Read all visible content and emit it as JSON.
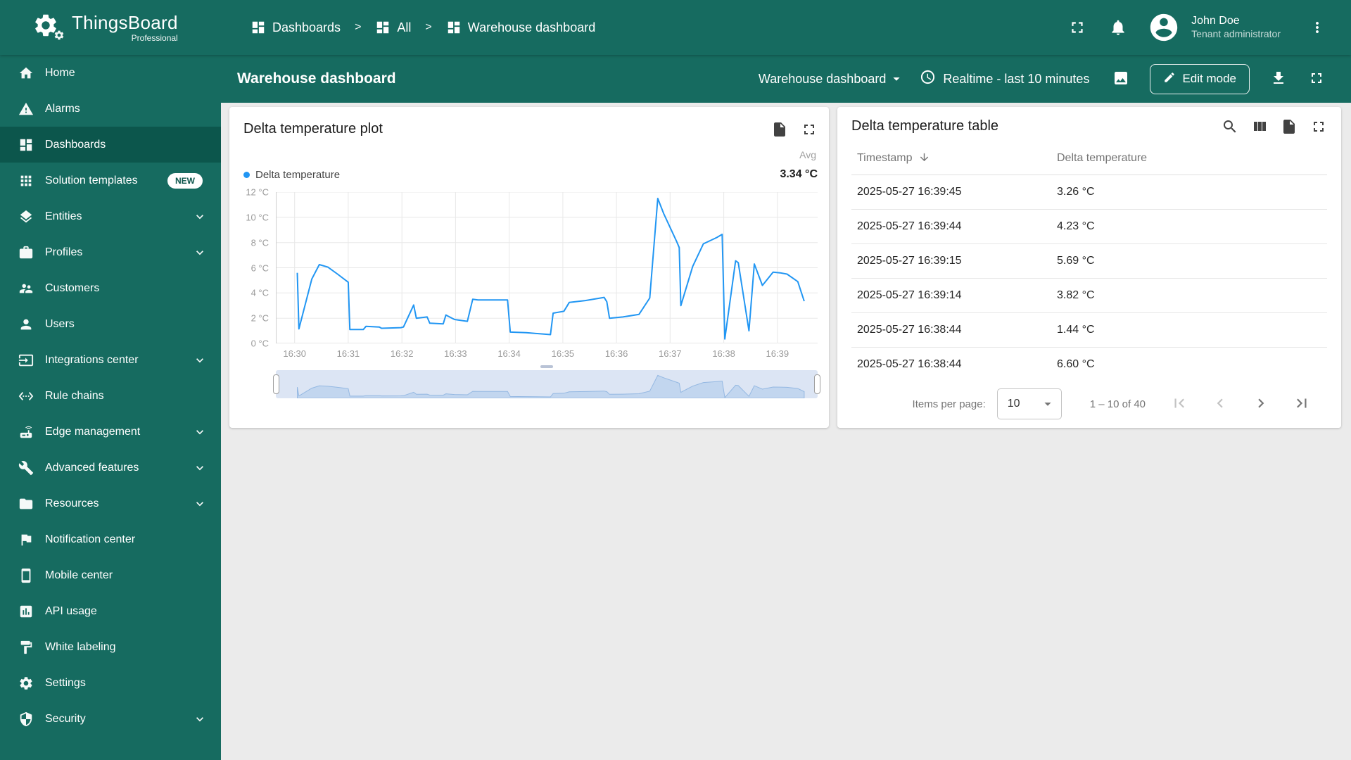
{
  "app": {
    "name": "ThingsBoard",
    "edition": "Professional"
  },
  "breadcrumb": {
    "separator": ">",
    "items": [
      {
        "label": "Dashboards",
        "icon": "dashboard"
      },
      {
        "label": "All",
        "icon": "dashboard"
      },
      {
        "label": "Warehouse dashboard",
        "icon": "dashboard"
      }
    ]
  },
  "user": {
    "name": "John Doe",
    "role": "Tenant administrator"
  },
  "header_actions": [
    "fullscreen",
    "notifications"
  ],
  "sidebar": {
    "items": [
      {
        "label": "Home",
        "icon": "home"
      },
      {
        "label": "Alarms",
        "icon": "alarms"
      },
      {
        "label": "Dashboards",
        "icon": "dashboard",
        "active": true
      },
      {
        "label": "Solution templates",
        "icon": "apps",
        "badge": "NEW"
      },
      {
        "label": "Entities",
        "icon": "entities",
        "expandable": true
      },
      {
        "label": "Profiles",
        "icon": "profiles",
        "expandable": true
      },
      {
        "label": "Customers",
        "icon": "customers"
      },
      {
        "label": "Users",
        "icon": "users"
      },
      {
        "label": "Integrations center",
        "icon": "integrations",
        "expandable": true
      },
      {
        "label": "Rule chains",
        "icon": "rule-chains"
      },
      {
        "label": "Edge management",
        "icon": "edge",
        "expandable": true
      },
      {
        "label": "Advanced features",
        "icon": "advanced",
        "expandable": true
      },
      {
        "label": "Resources",
        "icon": "resources",
        "expandable": true
      },
      {
        "label": "Notification center",
        "icon": "notification"
      },
      {
        "label": "Mobile center",
        "icon": "mobile"
      },
      {
        "label": "API usage",
        "icon": "api-usage"
      },
      {
        "label": "White labeling",
        "icon": "white-labeling"
      },
      {
        "label": "Settings",
        "icon": "settings"
      },
      {
        "label": "Security",
        "icon": "security",
        "expandable": true
      }
    ]
  },
  "toolbar": {
    "title": "Warehouse dashboard",
    "dashboard_select": "Warehouse dashboard",
    "time_window": "Realtime - last 10 minutes",
    "edit_button": "Edit mode",
    "actions": [
      "image",
      "download",
      "fullscreen"
    ]
  },
  "chart_card": {
    "title": "Delta temperature plot",
    "actions": [
      "file-export",
      "fullscreen"
    ],
    "legend": {
      "series_label": "Delta temperature",
      "agg_label": "Avg",
      "agg_value": "3.34 °C"
    }
  },
  "chart_data": {
    "type": "line",
    "title": "Delta temperature plot",
    "series_name": "Delta temperature",
    "color": "#2196f3",
    "ylim": [
      0,
      12
    ],
    "y_ticks": [
      "0 °C",
      "2 °C",
      "4 °C",
      "6 °C",
      "8 °C",
      "10 °C",
      "12 °C"
    ],
    "x_ticks": [
      "16:30",
      "16:31",
      "16:32",
      "16:33",
      "16:34",
      "16:35",
      "16:36",
      "16:37",
      "16:38",
      "16:39"
    ],
    "x_domain": [
      -0.35,
      9.75
    ],
    "grid": true,
    "legend_position": "top",
    "points": [
      [
        0.05,
        5.6
      ],
      [
        0.08,
        1.15
      ],
      [
        0.32,
        5.1
      ],
      [
        0.46,
        6.25
      ],
      [
        0.62,
        6.05
      ],
      [
        0.8,
        5.5
      ],
      [
        1.0,
        4.85
      ],
      [
        1.03,
        1.1
      ],
      [
        1.28,
        1.1
      ],
      [
        1.33,
        1.35
      ],
      [
        1.58,
        1.3
      ],
      [
        1.62,
        1.2
      ],
      [
        1.98,
        1.25
      ],
      [
        2.03,
        1.3
      ],
      [
        2.22,
        3.05
      ],
      [
        2.27,
        2.0
      ],
      [
        2.47,
        2.1
      ],
      [
        2.52,
        1.6
      ],
      [
        2.77,
        1.55
      ],
      [
        2.82,
        2.25
      ],
      [
        2.98,
        1.9
      ],
      [
        3.22,
        1.75
      ],
      [
        3.32,
        3.5
      ],
      [
        3.42,
        3.45
      ],
      [
        3.97,
        3.45
      ],
      [
        4.02,
        0.9
      ],
      [
        4.32,
        0.85
      ],
      [
        4.77,
        0.7
      ],
      [
        4.82,
        2.4
      ],
      [
        5.02,
        2.55
      ],
      [
        5.12,
        3.25
      ],
      [
        5.42,
        3.4
      ],
      [
        5.77,
        3.65
      ],
      [
        5.82,
        3.3
      ],
      [
        5.87,
        2.0
      ],
      [
        6.12,
        2.1
      ],
      [
        6.42,
        2.3
      ],
      [
        6.62,
        3.6
      ],
      [
        6.77,
        11.5
      ],
      [
        6.88,
        10.3
      ],
      [
        7.12,
        8.1
      ],
      [
        7.17,
        7.6
      ],
      [
        7.2,
        3.0
      ],
      [
        7.42,
        6.1
      ],
      [
        7.62,
        7.9
      ],
      [
        7.87,
        8.4
      ],
      [
        7.97,
        8.65
      ],
      [
        8.02,
        0.35
      ],
      [
        8.22,
        6.55
      ],
      [
        8.27,
        6.4
      ],
      [
        8.47,
        1.0
      ],
      [
        8.57,
        6.3
      ],
      [
        8.72,
        4.6
      ],
      [
        8.92,
        5.65
      ],
      [
        9.05,
        5.6
      ],
      [
        9.18,
        5.5
      ],
      [
        9.38,
        4.9
      ],
      [
        9.5,
        3.35
      ]
    ]
  },
  "table_card": {
    "title": "Delta temperature table",
    "actions": [
      "search",
      "view-columns",
      "file-export",
      "fullscreen"
    ],
    "columns": [
      "Timestamp",
      "Delta temperature"
    ],
    "rows": [
      {
        "timestamp": "2025-05-27 16:39:45",
        "value": "3.26 °C"
      },
      {
        "timestamp": "2025-05-27 16:39:44",
        "value": "4.23 °C"
      },
      {
        "timestamp": "2025-05-27 16:39:15",
        "value": "5.69 °C"
      },
      {
        "timestamp": "2025-05-27 16:39:14",
        "value": "3.82 °C"
      },
      {
        "timestamp": "2025-05-27 16:38:44",
        "value": "1.44 °C"
      },
      {
        "timestamp": "2025-05-27 16:38:44",
        "value": "6.60 °C"
      }
    ],
    "footer": {
      "items_per_page_label": "Items per page:",
      "items_per_page": "10",
      "range": "1 – 10 of 40"
    }
  },
  "colors": {
    "primary": "#166b60",
    "primary_active": "#0c564c",
    "series": "#2196f3"
  }
}
